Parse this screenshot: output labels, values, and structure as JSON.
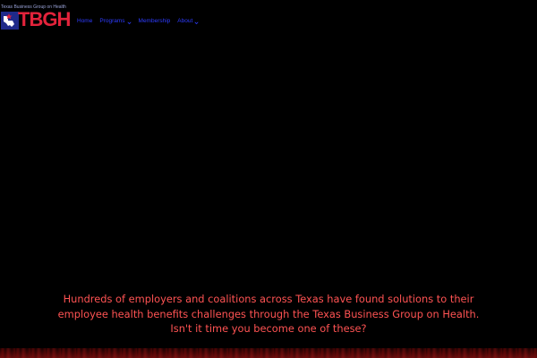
{
  "brand": {
    "tagline": "Texas Business Group on Health",
    "wordmark": "TBGH",
    "colors": {
      "red": "#e3233b",
      "blue": "#1f2a8a",
      "nav": "#2e3cff",
      "hero_text": "#ff5353"
    }
  },
  "nav": {
    "items": [
      {
        "label": "Home",
        "has_dropdown": false
      },
      {
        "label": "Programs",
        "has_dropdown": true
      },
      {
        "label": "Membership",
        "has_dropdown": false
      },
      {
        "label": "About",
        "has_dropdown": true
      }
    ],
    "dropdown_icon": "chevron-down-icon"
  },
  "hero": {
    "lines": [
      "Hundreds of employers and coalitions across Texas have found solutions to their",
      "employee health benefits challenges through the Texas Business Group on Health.",
      "Isn't it time you become one of these?"
    ]
  }
}
